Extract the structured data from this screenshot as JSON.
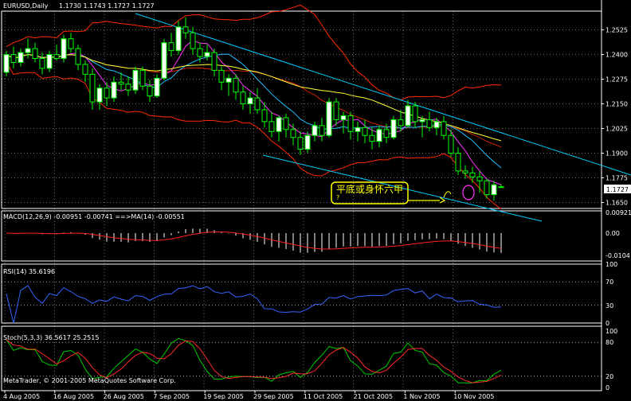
{
  "window": {
    "title": "EURUSD,Daily",
    "ohlc": "1.1730 1.1743 1.1727 1.1727",
    "copyright": "MetaTrader, © 2001-2005 MetaQuotes Software Corp."
  },
  "colors": {
    "background": "#000000",
    "grid": "#ffffff",
    "bull_candle": "#ffffff",
    "bear_candle": "#000000",
    "candle_wick": "#00ff00",
    "bands": "#ff2a00",
    "ma_fast": "#ff33ff",
    "ma_mid": "#20c0ff",
    "ma_slow": "#ffff33",
    "trendline": "#00ccff",
    "macd_hist": "#ffffff",
    "macd_signal": "#ff2222",
    "rsi_line": "#3366ff",
    "stoch_main": "#00cc00",
    "stoch_signal": "#ff2a2a",
    "annotation": "#ffff00",
    "current_price_label_bg": "#ffffff"
  },
  "main_panel": {
    "price_axis_labels": [
      "1.2525",
      "1.2400",
      "1.2275",
      "1.2150",
      "1.2025",
      "1.1900",
      "1.1775",
      "1.1650"
    ],
    "current_price": "1.1727",
    "annotation_text": "平底或身怀六甲",
    "annotation_mark": "?"
  },
  "macd_panel": {
    "title": "MACD(12,26,9) -0.00951 -0.00741 ==>MA(14) -0.00551",
    "axis_labels": [
      "0.00921",
      "0.00",
      "-0.0104"
    ]
  },
  "rsi_panel": {
    "title": "RSI(14) 35.6196",
    "axis_labels": [
      "100",
      "70",
      "30",
      "0"
    ]
  },
  "stoch_panel": {
    "title": "Stoch(5,3,3) 36.5617 25.2515",
    "axis_labels": [
      "100",
      "80",
      "20",
      "0"
    ]
  },
  "time_axis_labels": [
    "4 Aug 2005",
    "16 Aug 2005",
    "26 Aug 2005",
    "7 Sep 2005",
    "19 Sep 2005",
    "29 Sep 2005",
    "11 Oct 2005",
    "21 Oct 2005",
    "1 Nov 2005",
    "10 Nov 2005"
  ],
  "chart_data": {
    "type": "candlestick",
    "symbol": "EURUSD",
    "timeframe": "Daily",
    "ylim": [
      1.162,
      1.262
    ],
    "candles": [
      [
        1.231,
        1.242,
        1.229,
        1.24
      ],
      [
        1.24,
        1.244,
        1.233,
        1.236
      ],
      [
        1.236,
        1.243,
        1.234,
        1.241
      ],
      [
        1.241,
        1.248,
        1.238,
        1.243
      ],
      [
        1.243,
        1.246,
        1.236,
        1.238
      ],
      [
        1.238,
        1.241,
        1.23,
        1.233
      ],
      [
        1.233,
        1.242,
        1.231,
        1.24
      ],
      [
        1.24,
        1.245,
        1.237,
        1.238
      ],
      [
        1.238,
        1.25,
        1.236,
        1.248
      ],
      [
        1.248,
        1.251,
        1.241,
        1.243
      ],
      [
        1.243,
        1.245,
        1.232,
        1.235
      ],
      [
        1.235,
        1.237,
        1.226,
        1.23
      ],
      [
        1.23,
        1.233,
        1.212,
        1.216
      ],
      [
        1.216,
        1.225,
        1.212,
        1.223
      ],
      [
        1.223,
        1.226,
        1.214,
        1.218
      ],
      [
        1.218,
        1.229,
        1.216,
        1.226
      ],
      [
        1.226,
        1.231,
        1.222,
        1.225
      ],
      [
        1.225,
        1.229,
        1.219,
        1.222
      ],
      [
        1.222,
        1.234,
        1.22,
        1.232
      ],
      [
        1.232,
        1.234,
        1.222,
        1.224
      ],
      [
        1.224,
        1.227,
        1.216,
        1.219
      ],
      [
        1.219,
        1.23,
        1.218,
        1.228
      ],
      [
        1.228,
        1.248,
        1.227,
        1.246
      ],
      [
        1.246,
        1.251,
        1.239,
        1.242
      ],
      [
        1.242,
        1.257,
        1.24,
        1.254
      ],
      [
        1.254,
        1.259,
        1.248,
        1.251
      ],
      [
        1.251,
        1.254,
        1.24,
        1.243
      ],
      [
        1.243,
        1.246,
        1.236,
        1.239
      ],
      [
        1.239,
        1.245,
        1.237,
        1.241
      ],
      [
        1.241,
        1.243,
        1.229,
        1.232
      ],
      [
        1.232,
        1.234,
        1.222,
        1.226
      ],
      [
        1.226,
        1.23,
        1.219,
        1.228
      ],
      [
        1.228,
        1.23,
        1.217,
        1.221
      ],
      [
        1.221,
        1.224,
        1.212,
        1.215
      ],
      [
        1.215,
        1.221,
        1.21,
        1.218
      ],
      [
        1.218,
        1.223,
        1.21,
        1.212
      ],
      [
        1.212,
        1.216,
        1.203,
        1.206
      ],
      [
        1.206,
        1.211,
        1.198,
        1.201
      ],
      [
        1.201,
        1.209,
        1.196,
        1.208
      ],
      [
        1.208,
        1.21,
        1.198,
        1.202
      ],
      [
        1.202,
        1.205,
        1.194,
        1.198
      ],
      [
        1.198,
        1.201,
        1.189,
        1.192
      ],
      [
        1.192,
        1.201,
        1.19,
        1.199
      ],
      [
        1.199,
        1.206,
        1.196,
        1.204
      ],
      [
        1.204,
        1.208,
        1.196,
        1.199
      ],
      [
        1.199,
        1.218,
        1.198,
        1.216
      ],
      [
        1.216,
        1.218,
        1.204,
        1.207
      ],
      [
        1.207,
        1.211,
        1.2,
        1.209
      ],
      [
        1.209,
        1.211,
        1.197,
        1.201
      ],
      [
        1.201,
        1.206,
        1.196,
        1.203
      ],
      [
        1.203,
        1.207,
        1.195,
        1.199
      ],
      [
        1.199,
        1.203,
        1.192,
        1.196
      ],
      [
        1.196,
        1.204,
        1.193,
        1.202
      ],
      [
        1.202,
        1.205,
        1.195,
        1.198
      ],
      [
        1.198,
        1.209,
        1.197,
        1.207
      ],
      [
        1.207,
        1.212,
        1.201,
        1.204
      ],
      [
        1.204,
        1.217,
        1.203,
        1.214
      ],
      [
        1.214,
        1.216,
        1.203,
        1.206
      ],
      [
        1.206,
        1.209,
        1.198,
        1.207
      ],
      [
        1.207,
        1.211,
        1.201,
        1.203
      ],
      [
        1.203,
        1.208,
        1.199,
        1.206
      ],
      [
        1.206,
        1.209,
        1.197,
        1.199
      ],
      [
        1.199,
        1.202,
        1.188,
        1.19
      ],
      [
        1.19,
        1.193,
        1.179,
        1.181
      ],
      [
        1.181,
        1.184,
        1.177,
        1.18
      ],
      [
        1.18,
        1.183,
        1.175,
        1.178
      ],
      [
        1.178,
        1.181,
        1.17,
        1.176
      ],
      [
        1.176,
        1.177,
        1.167,
        1.169
      ],
      [
        1.169,
        1.176,
        1.166,
        1.174
      ],
      [
        1.173,
        1.1743,
        1.1727,
        1.1727
      ]
    ],
    "price_labels": [
      "1.2525",
      "1.2400",
      "1.2275",
      "1.2150",
      "1.2025",
      "1.1900",
      "1.1775",
      "1.1650"
    ],
    "time_labels": [
      "4 Aug 2005",
      "16 Aug 2005",
      "26 Aug 2005",
      "7 Sep 2005",
      "19 Sep 2005",
      "29 Sep 2005",
      "11 Oct 2005",
      "21 Oct 2005",
      "1 Nov 2005",
      "10 Nov 2005"
    ]
  }
}
